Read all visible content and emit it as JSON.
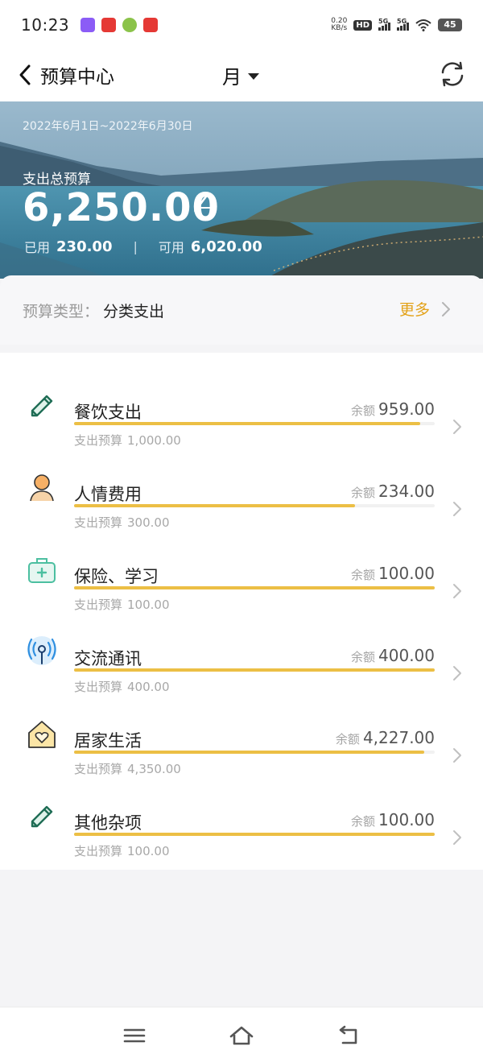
{
  "status_bar": {
    "time": "10:23",
    "net_speed_value": "0.20",
    "net_speed_unit": "KB/s",
    "hd_badge": "HD",
    "signal_1": "5G",
    "signal_2": "5G",
    "battery": "45",
    "app_icon_colors": [
      "#8b5cf6",
      "#e53935",
      "#8bc34a",
      "#e53935"
    ]
  },
  "header": {
    "title": "预算中心",
    "period": "月",
    "icons": {
      "back": "back-icon",
      "period_dropdown": "caret-down-icon",
      "refresh": "refresh-icon"
    }
  },
  "hero": {
    "date_range": "2022年6月1日~2022年6月30日",
    "total_label": "支出总预算",
    "total_value": "6,250.00",
    "used_label": "已用",
    "used_value": "230.00",
    "separator": "|",
    "available_label": "可用",
    "available_value": "6,020.00"
  },
  "budget_type": {
    "label": "预算类型：",
    "value": "分类支出",
    "more": "更多"
  },
  "items": [
    {
      "name": "餐饮支出",
      "remain_label": "余额",
      "remain": "959.00",
      "budget_label": "支出预算",
      "budget": "1,000.00",
      "progress": 0.959,
      "icon": "pencil-icon"
    },
    {
      "name": "人情费用",
      "remain_label": "余额",
      "remain": "234.00",
      "budget_label": "支出预算",
      "budget": "300.00",
      "progress": 0.78,
      "icon": "person-icon"
    },
    {
      "name": "保险、学习",
      "remain_label": "余额",
      "remain": "100.00",
      "budget_label": "支出预算",
      "budget": "100.00",
      "progress": 1.0,
      "icon": "medical-kit-icon"
    },
    {
      "name": "交流通讯",
      "remain_label": "余额",
      "remain": "400.00",
      "budget_label": "支出预算",
      "budget": "400.00",
      "progress": 1.0,
      "icon": "antenna-icon"
    },
    {
      "name": "居家生活",
      "remain_label": "余额",
      "remain": "4,227.00",
      "budget_label": "支出预算",
      "budget": "4,350.00",
      "progress": 0.972,
      "icon": "home-heart-icon"
    },
    {
      "name": "其他杂项",
      "remain_label": "余额",
      "remain": "100.00",
      "budget_label": "支出预算",
      "budget": "100.00",
      "progress": 1.0,
      "icon": "pencil-icon"
    }
  ],
  "colors": {
    "accent_orange": "#e3a21a",
    "progress_fill": "#ecbf45",
    "icon_green": "#2e9d7a",
    "icon_orange": "#f0a04b",
    "icon_blue": "#2f8fe0",
    "icon_yellow": "#f5c84c"
  },
  "nav": {
    "icons": [
      "menu-icon",
      "home-icon",
      "back-nav-icon"
    ]
  }
}
